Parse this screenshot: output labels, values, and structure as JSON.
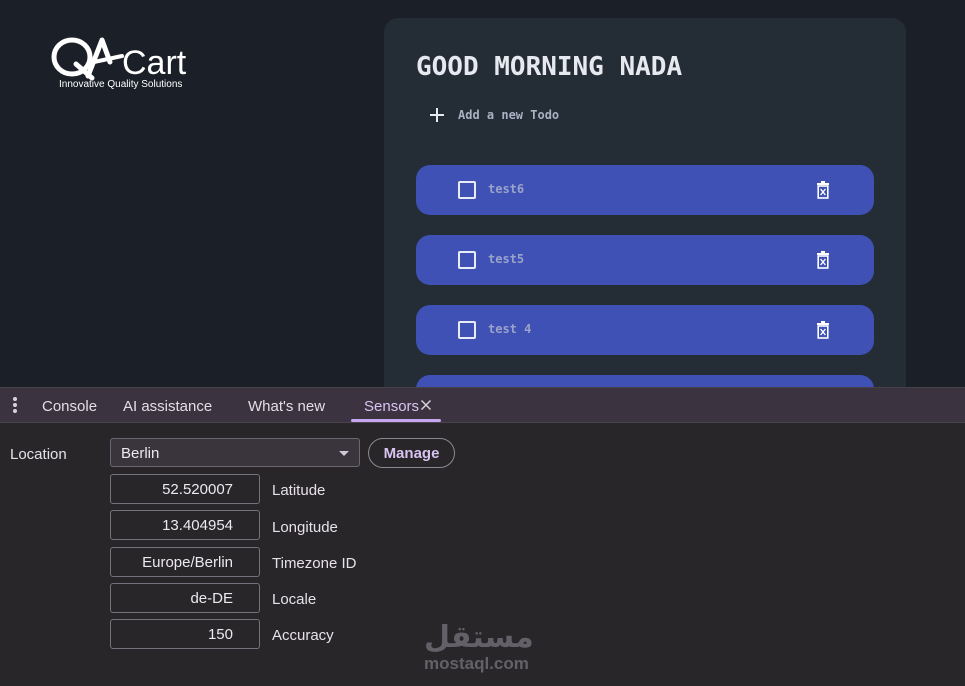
{
  "app": {
    "logo": {
      "brand": "QACart",
      "tagline": "Innovative Quality Solutions"
    },
    "greeting": "GOOD MORNING NADA",
    "add_todo_label": "Add a new Todo",
    "todos": [
      {
        "text": "test6"
      },
      {
        "text": "test5"
      },
      {
        "text": "test 4"
      },
      {
        "text": ""
      }
    ],
    "colors": {
      "background": "#1b1f27",
      "panel": "#242c36",
      "todo_item": "#3f51b5"
    }
  },
  "devtools": {
    "tabs": [
      {
        "label": "Console"
      },
      {
        "label": "AI assistance"
      },
      {
        "label": "What's new"
      },
      {
        "label": "Sensors",
        "active": true
      }
    ],
    "sensors": {
      "location_label": "Location",
      "location_value": "Berlin",
      "manage_label": "Manage",
      "fields": [
        {
          "label": "Latitude",
          "value": "52.520007"
        },
        {
          "label": "Longitude",
          "value": "13.404954"
        },
        {
          "label": "Timezone ID",
          "value": "Europe/Berlin"
        },
        {
          "label": "Locale",
          "value": "de-DE"
        },
        {
          "label": "Accuracy",
          "value": "150"
        }
      ]
    },
    "colors": {
      "accent": "#c7a8f0"
    }
  },
  "watermark": {
    "arabic": "مستقل",
    "latin": "mostaql.com"
  }
}
